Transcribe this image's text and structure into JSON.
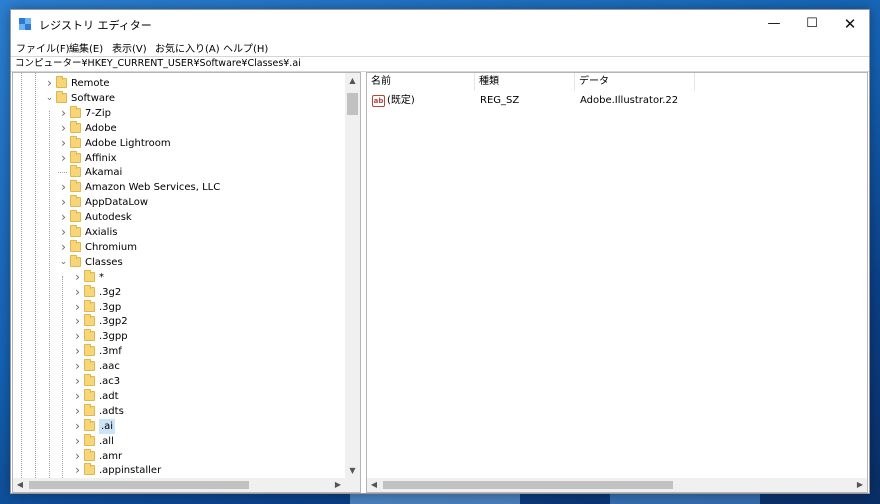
{
  "window": {
    "title": "レジストリ エディター",
    "buttons": {
      "minimize": "—",
      "maximize": "☐",
      "close": "✕"
    }
  },
  "menu": [
    "ファイル(F)",
    "編集(E)",
    "表示(V)",
    "お気に入り(A)",
    "ヘルプ(H)"
  ],
  "address": "コンピューター¥HKEY_CURRENT_USER¥Software¥Classes¥.ai",
  "tree": {
    "top": [
      {
        "label": "Remote",
        "expanded": false
      },
      {
        "label": "Software",
        "expanded": true
      }
    ],
    "software_children": [
      {
        "label": "7-Zip",
        "expander": true
      },
      {
        "label": "Adobe",
        "expander": true
      },
      {
        "label": "Adobe Lightroom",
        "expander": true
      },
      {
        "label": "Affinix",
        "expander": true
      },
      {
        "label": "Akamai",
        "expander": false
      },
      {
        "label": "Amazon Web Services, LLC",
        "expander": true
      },
      {
        "label": "AppDataLow",
        "expander": true
      },
      {
        "label": "Autodesk",
        "expander": true
      },
      {
        "label": "Axialis",
        "expander": true
      },
      {
        "label": "Chromium",
        "expander": true
      },
      {
        "label": "Classes",
        "expander": true,
        "expanded": true
      }
    ],
    "classes_children": [
      {
        "label": "*"
      },
      {
        "label": ".3g2"
      },
      {
        "label": ".3gp"
      },
      {
        "label": ".3gp2"
      },
      {
        "label": ".3gpp"
      },
      {
        "label": ".3mf"
      },
      {
        "label": ".aac"
      },
      {
        "label": ".ac3"
      },
      {
        "label": ".adt"
      },
      {
        "label": ".adts"
      },
      {
        "label": ".ai",
        "selected": true
      },
      {
        "label": ".all"
      },
      {
        "label": ".amr"
      },
      {
        "label": ".appinstaller"
      }
    ]
  },
  "values": {
    "columns": [
      "名前",
      "種類",
      "データ"
    ],
    "rows": [
      {
        "icon": "ab",
        "name": "(既定)",
        "type": "REG_SZ",
        "data": "Adobe.Illustrator.22"
      }
    ]
  },
  "icons": {
    "collapsed": "›",
    "expanded": "⌄",
    "scroll_up": "▲",
    "scroll_down": "▼",
    "scroll_left": "◀",
    "scroll_right": "▶"
  },
  "colors": {
    "folder": "#f7d67a",
    "selection": "#cce4f7",
    "desktop": "#1462b3"
  }
}
